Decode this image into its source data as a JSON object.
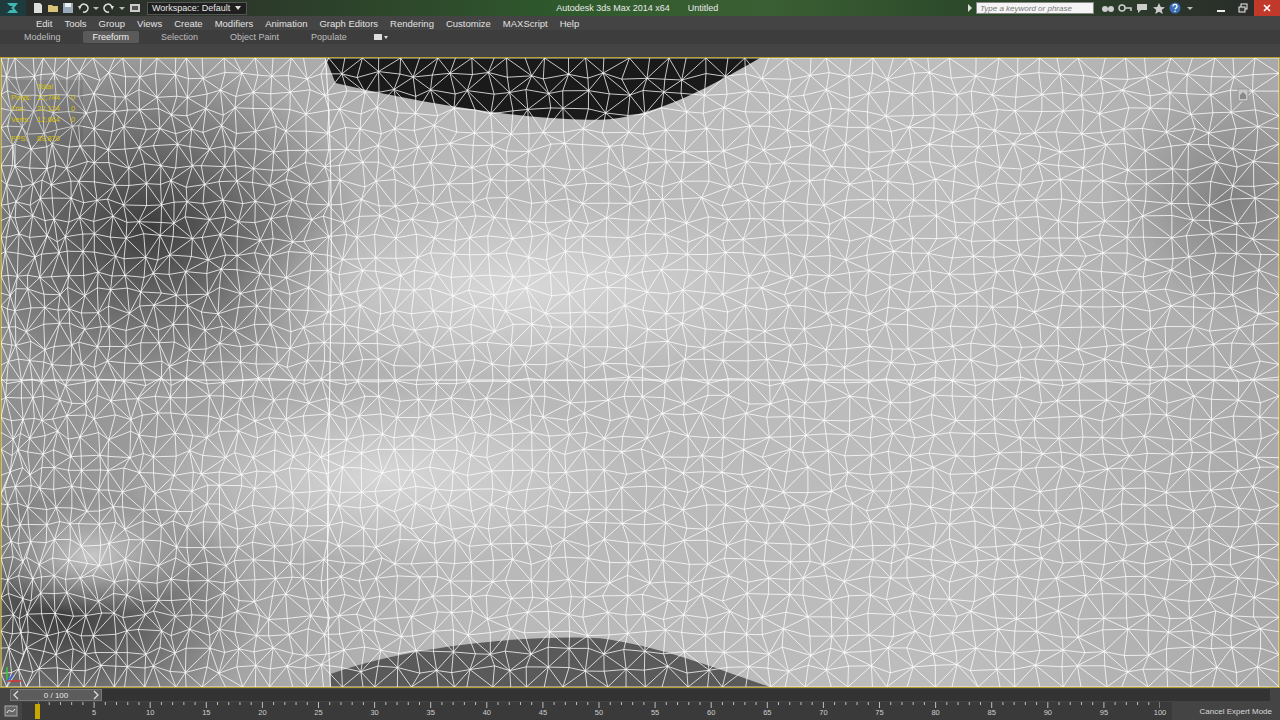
{
  "window": {
    "title": "Autodesk 3ds Max 2014 x64",
    "document": "Untitled"
  },
  "workspace": {
    "label": "Workspace: Default"
  },
  "search": {
    "placeholder": "Type a keyword or phrase"
  },
  "menu": [
    "Edit",
    "Tools",
    "Group",
    "Views",
    "Create",
    "Modifiers",
    "Animation",
    "Graph Editors",
    "Rendering",
    "Customize",
    "MAXScript",
    "Help"
  ],
  "ribbon_tabs": [
    {
      "label": "Modeling",
      "selected": false
    },
    {
      "label": "Freeform",
      "selected": true
    },
    {
      "label": "Selection",
      "selected": false
    },
    {
      "label": "Object Paint",
      "selected": false
    },
    {
      "label": "Populate",
      "selected": false
    }
  ],
  "viewport": {
    "active": true,
    "stats": {
      "header": "Total",
      "rows": [
        {
          "label": "Polys:",
          "total": "12,744",
          "selected": "0"
        },
        {
          "label": "Tris:",
          "total": "22,124",
          "selected": "0"
        },
        {
          "label": "Verts:",
          "total": "12,664",
          "selected": "0"
        }
      ],
      "fps": {
        "label": "FPS:",
        "value": "89.870"
      }
    }
  },
  "time_slider": {
    "label": "0 / 100",
    "level": 0
  },
  "timeline": {
    "ticks": [
      "5",
      "10",
      "15",
      "20",
      "25",
      "30",
      "35",
      "40",
      "45",
      "50",
      "55",
      "60",
      "65",
      "70",
      "75",
      "80",
      "85",
      "90",
      "95",
      "100"
    ]
  },
  "status": {
    "button": "Cancel Expert Mode"
  }
}
